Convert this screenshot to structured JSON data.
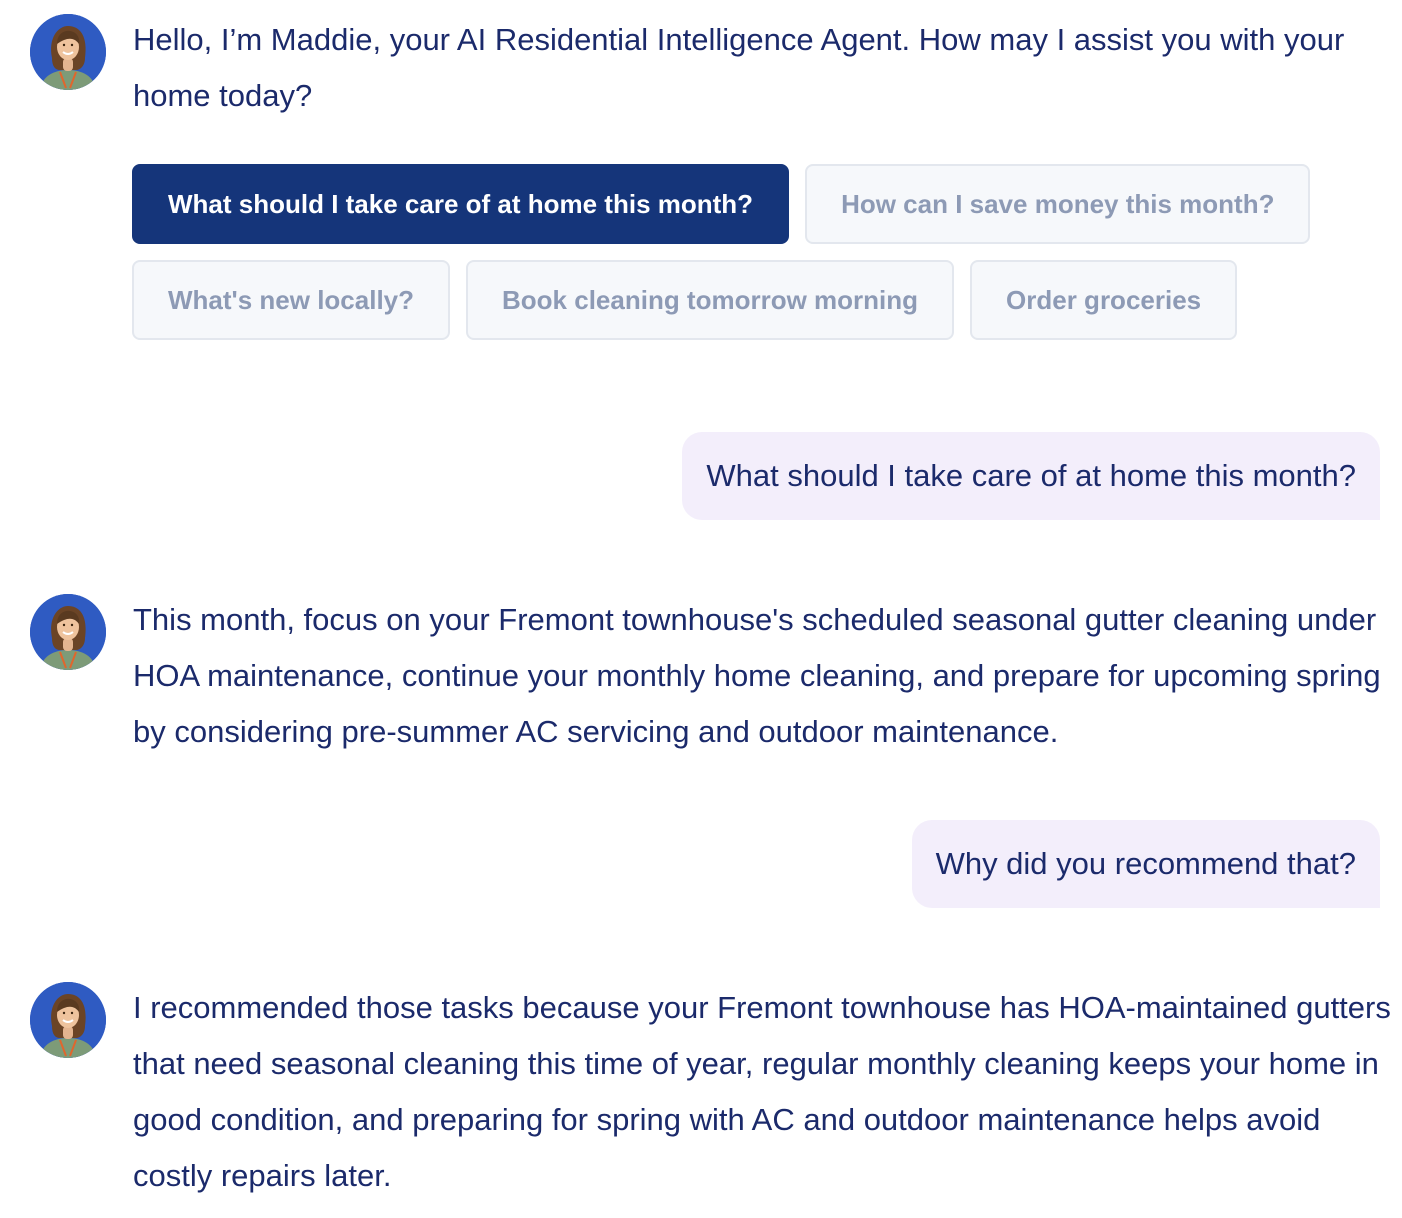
{
  "colors": {
    "text": "#1b2a6b",
    "accent": "#15357a",
    "chip_bg": "#f6f8fb",
    "chip_text": "#8d9ab5",
    "user_bubble_bg": "#f3eefb",
    "avatar_bg": "#2f5bc2"
  },
  "conversation": {
    "greeting": {
      "avatar_icon": "assistant-avatar-icon",
      "text": "Hello, I’m Maddie, your AI Residential Intelligence Agent. How may I assist you with your home today?"
    },
    "suggestions": [
      {
        "label": "What should I take care of at home this month?",
        "selected": true
      },
      {
        "label": "How can I save money this month?",
        "selected": false
      },
      {
        "label": "What's new locally?",
        "selected": false
      },
      {
        "label": "Book cleaning tomorrow morning",
        "selected": false
      },
      {
        "label": "Order groceries",
        "selected": false
      }
    ],
    "user_message_1": "What should I take care of at home this month?",
    "agent_reply_1": "This month, focus on your Fremont townhouse's scheduled seasonal gutter cleaning under HOA maintenance, continue your monthly home cleaning, and prepare for upcoming spring by considering pre-summer AC servicing and outdoor maintenance.",
    "user_message_2": "Why did you recommend that?",
    "agent_reply_2": "I recommended those tasks because your Fremont townhouse has HOA-maintained gutters that need seasonal cleaning this time of year, regular monthly cleaning keeps your home in good condition, and preparing for spring with AC and outdoor maintenance helps avoid costly repairs later."
  }
}
